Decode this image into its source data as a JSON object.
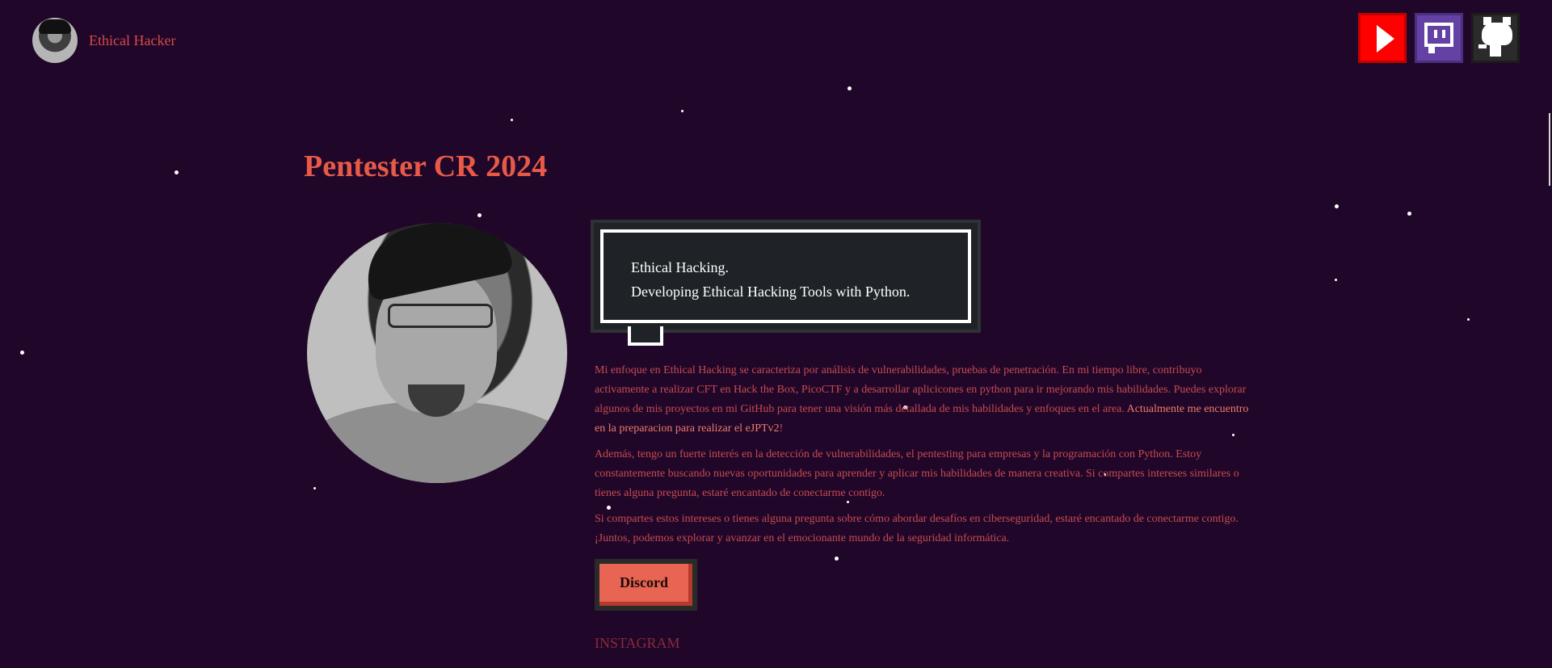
{
  "header": {
    "brand_name": "Ethical Hacker"
  },
  "social": {
    "youtube_icon": "youtube-icon",
    "twitch_icon": "twitch-icon",
    "github_icon": "github-icon",
    "colors": {
      "youtube": "#fe0000",
      "twitch": "#6441a5",
      "github": "#2b2b2b"
    }
  },
  "hero": {
    "title": "Pentester CR 2024",
    "speech_line_1": "Ethical Hacking.",
    "speech_line_2": "Developing Ethical Hacking Tools with Python."
  },
  "bio": {
    "p1_text": "Mi enfoque en Ethical Hacking se caracteriza por análisis de vulnerabilidades, pruebas de penetración. En mi tiempo libre, contribuyo activamente a realizar CFT en Hack the Box, PicoCTF y a desarrollar aplicicones en python para ir mejorando mis habilidades. Puedes explorar algunos de mis proyectos en mi GitHub para tener una visión más detallada de mis habilidades y enfoques en el area. ",
    "p1_highlight": "Actualmente me encuentro en la preparacion para realizar el eJPTv2",
    "p1_end": "!",
    "p2": "Además, tengo un fuerte interés en la detección de vulnerabilidades, el pentesting para empresas y la programación con Python. Estoy constantemente buscando nuevas oportunidades para aprender y aplicar mis habilidades de manera creativa. Si compartes intereses similares o tienes alguna pregunta, estaré encantado de conectarme contigo.",
    "p3": "Si compartes estos intereses o tienes alguna pregunta sobre cómo abordar desafíos en ciberseguridad, estaré encantado de conectarme contigo. ¡Juntos, podemos explorar y avanzar en el emocionante mundo de la seguridad informática."
  },
  "actions": {
    "discord_label": "Discord",
    "instagram_label": "INSTAGRAM"
  },
  "theme": {
    "background": "#200729",
    "accent": "#e85a48"
  }
}
